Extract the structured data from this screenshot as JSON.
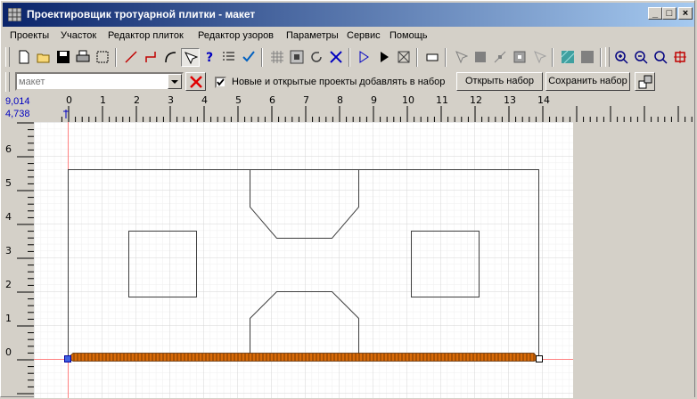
{
  "window": {
    "title": "Проектировщик тротуарной плитки - макет",
    "minimize_glyph": "_",
    "maximize_glyph": "□",
    "close_glyph": "×"
  },
  "menu": [
    "Проекты",
    "Участок",
    "Редактор плиток",
    "Редактор узоров",
    "Параметры",
    "Сервис",
    "Помощь"
  ],
  "toolbar": {
    "icons": [
      "new-file-icon",
      "open-folder-icon",
      "save-icon",
      "print-icon",
      "select-area-icon",
      "line-tool-icon",
      "polyline-tool-icon",
      "arc-tool-icon",
      "select-tool-icon",
      "help-pointer-icon",
      "list-icon",
      "check-icon",
      "grid-icon",
      "tile-icon",
      "rotate-icon",
      "delete-icon",
      "step-icon",
      "play-icon",
      "stop-icon",
      "eraser-icon",
      "arrow-pointer-icon",
      "fill-icon",
      "node-icon",
      "target-icon",
      "cursor-icon",
      "texture-icon",
      "gray-square-icon",
      "zoom-in-icon",
      "zoom-out-icon",
      "zoom-fit-icon",
      "zoom-box-icon"
    ]
  },
  "projectbar": {
    "project_combo_placeholder": "макет",
    "clear_icon": "red-x-icon",
    "add_to_set_checked": true,
    "add_to_set_label": "Новые и открытые проекты добавлять в набор",
    "open_set_label": "Открыть набор",
    "save_set_label": "Сохранить набор",
    "set_layout_icon": "layout-icon"
  },
  "coords": {
    "x": "9,014",
    "y": "4,738"
  },
  "ruler": {
    "x_ticks": [
      "0",
      "1",
      "2",
      "3",
      "4",
      "5",
      "6",
      "7",
      "8",
      "9",
      "10",
      "11",
      "12",
      "13",
      "14"
    ],
    "y_ticks": [
      "0",
      "1",
      "2",
      "3",
      "4",
      "5",
      "6"
    ]
  },
  "colors": {
    "title_gradient_start": "#0a246a",
    "title_gradient_end": "#a6caf0",
    "outline": "#404040",
    "border_strip": "#d86a08",
    "axis": "#ff8080",
    "grid": "#e4e4e4",
    "coords": "#0000c0"
  }
}
